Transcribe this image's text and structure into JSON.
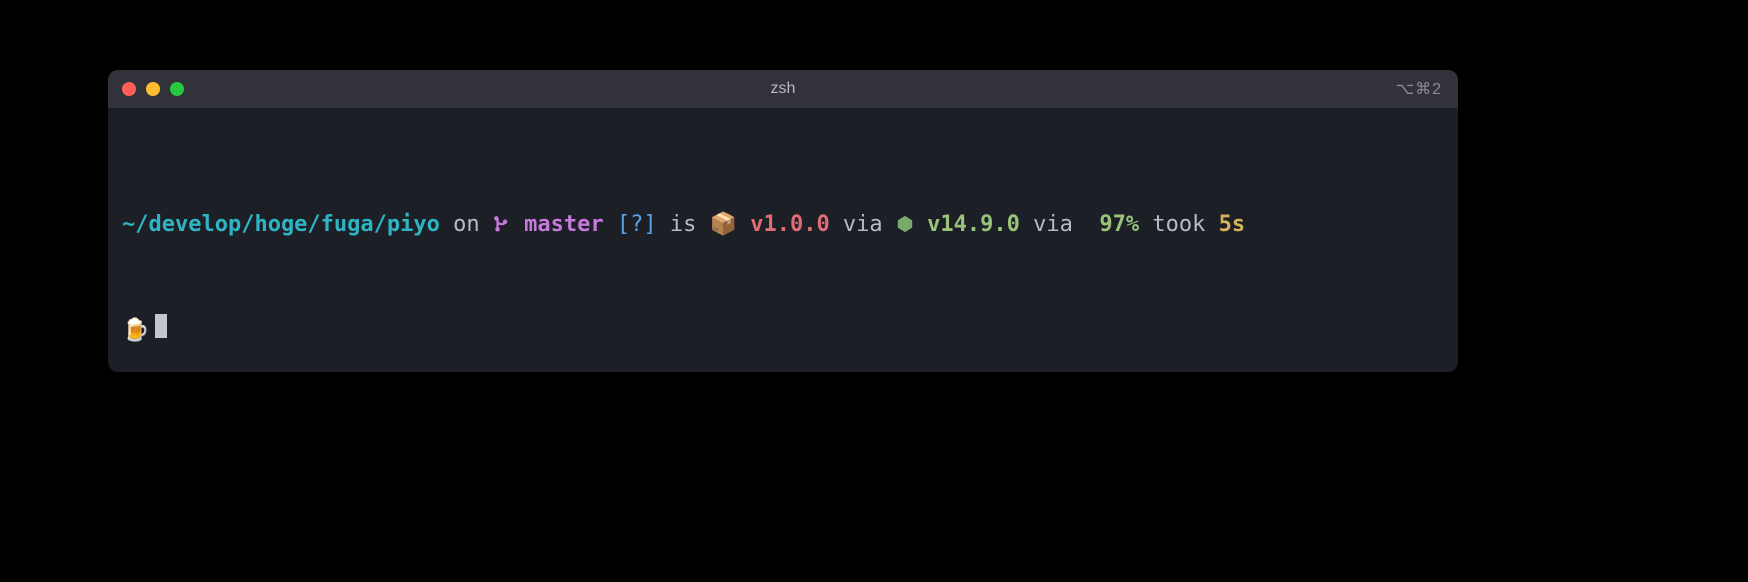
{
  "titlebar": {
    "title": "zsh",
    "right_hint": "⌥⌘2"
  },
  "prompt": {
    "cwd": "~/develop/hoge/fuga/piyo",
    "on": " on ",
    "branch_icon": "",
    "branch": " master",
    "git_status": " [?]",
    "is": " is ",
    "pkg_icon": "📦",
    "pkg_version": " v1.0.0",
    "via1": " via ",
    "node_version": " v14.9.0",
    "via2": " via  ",
    "battery": "97%",
    "took": " took ",
    "duration": "5s",
    "prompt_symbol": "🍺"
  }
}
